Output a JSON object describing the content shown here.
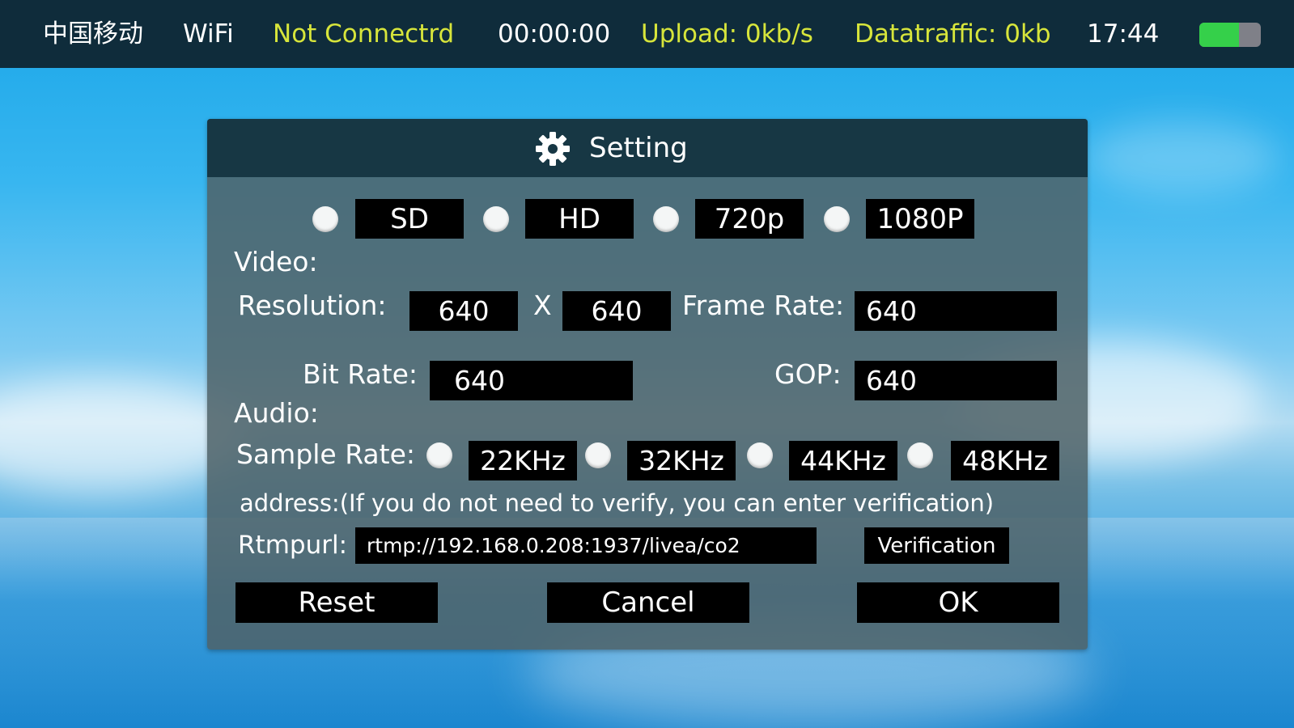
{
  "status_bar": {
    "carrier": "中国移动",
    "network": "WiFi",
    "connection_status": "Not Connectrd",
    "timer": "00:00:00",
    "upload": "Upload: 0kb/s",
    "data_traffic": "Datatraffic: 0kb",
    "time": "17:44",
    "battery_level": 0.65,
    "colors": {
      "bar": "#0f2c3b",
      "status_text": "#d7e53b",
      "battery_fill": "#35d04a"
    }
  },
  "dialog": {
    "title": "Setting",
    "title_icon": "gear-icon",
    "presets": [
      "SD",
      "HD",
      "720p",
      "1080P"
    ],
    "video": {
      "section_label": "Video:",
      "resolution_label": "Resolution:",
      "resolution_width": "640",
      "resolution_separator": "X",
      "resolution_height": "640",
      "frame_rate_label": "Frame Rate:",
      "frame_rate": "640",
      "bit_rate_label": "Bit Rate:",
      "bit_rate": "640",
      "gop_label": "GOP:",
      "gop": "640"
    },
    "audio": {
      "section_label": "Audio:",
      "sample_rate_label": "Sample Rate:",
      "sample_rates": [
        "22KHz",
        "32KHz",
        "44KHz",
        "48KHz"
      ]
    },
    "address_note": "address:(If you do not need to  verify, you can enter verification)",
    "rtmp": {
      "label": "Rtmpurl:",
      "value": "rtmp://192.168.0.208:1937/livea/co2",
      "verify_button": "Verification"
    },
    "buttons": {
      "reset": "Reset",
      "cancel": "Cancel",
      "ok": "OK"
    }
  }
}
